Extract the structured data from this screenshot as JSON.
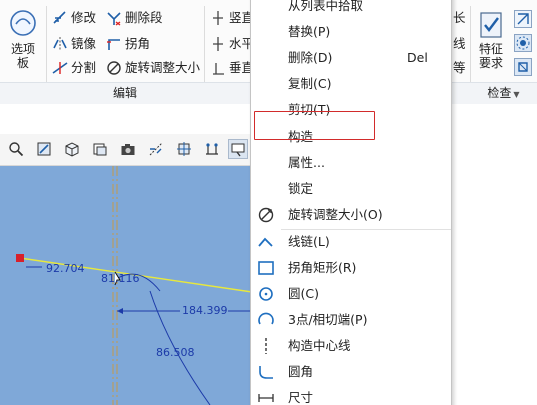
{
  "ribbon": {
    "panel_button": "选项\n板",
    "edit_tools": [
      {
        "label": "修改",
        "icon": "modify-icon"
      },
      {
        "label": "删除段",
        "icon": "delete-segment-icon"
      },
      {
        "label": "镜像",
        "icon": "mirror-icon"
      },
      {
        "label": "拐角",
        "icon": "corner-icon"
      },
      {
        "label": "分割",
        "icon": "divide-icon"
      },
      {
        "label": "旋转调整大小",
        "icon": "rotate-resize-icon"
      }
    ],
    "constraint_tools": [
      {
        "label": "竖直",
        "icon": "vertical-icon"
      },
      {
        "label": "水平",
        "icon": "horizontal-icon"
      },
      {
        "label": "垂直",
        "icon": "perpendicular-icon"
      }
    ],
    "right_fragments": [
      "长",
      "线",
      "等"
    ],
    "feature_button": "特征\n要求",
    "groups": {
      "edit": "编辑",
      "inspect": "检查"
    }
  },
  "dimensions": {
    "d1": "92.704",
    "d2": "81.116",
    "d3": "184.399",
    "d4": "86.508"
  },
  "context_menu": {
    "items": [
      {
        "label": "从列表中拾取",
        "shortcut": ""
      },
      {
        "label": "替换(P)",
        "shortcut": ""
      },
      {
        "label": "删除(D)",
        "shortcut": "Del"
      },
      {
        "label": "复制(C)",
        "shortcut": ""
      },
      {
        "label": "剪切(T)",
        "shortcut": ""
      },
      {
        "label": "构造",
        "shortcut": ""
      },
      {
        "label": "属性...",
        "shortcut": ""
      },
      {
        "label": "锁定",
        "shortcut": ""
      },
      {
        "label": "旋转调整大小(O)",
        "shortcut": ""
      },
      {
        "label": "线链(L)",
        "shortcut": ""
      },
      {
        "label": "拐角矩形(R)",
        "shortcut": ""
      },
      {
        "label": "圆(C)",
        "shortcut": ""
      },
      {
        "label": "3点/相切端(P)",
        "shortcut": ""
      },
      {
        "label": "构造中心线",
        "shortcut": ""
      },
      {
        "label": "圆角",
        "shortcut": ""
      },
      {
        "label": "尺寸",
        "shortcut": ""
      }
    ]
  },
  "colors": {
    "canvas": "#7fa8d8",
    "highlight_box": "#d22b2b",
    "sketch_line": "#e8e83c",
    "dimension": "#1c3aa8",
    "point": "#d8202a"
  }
}
